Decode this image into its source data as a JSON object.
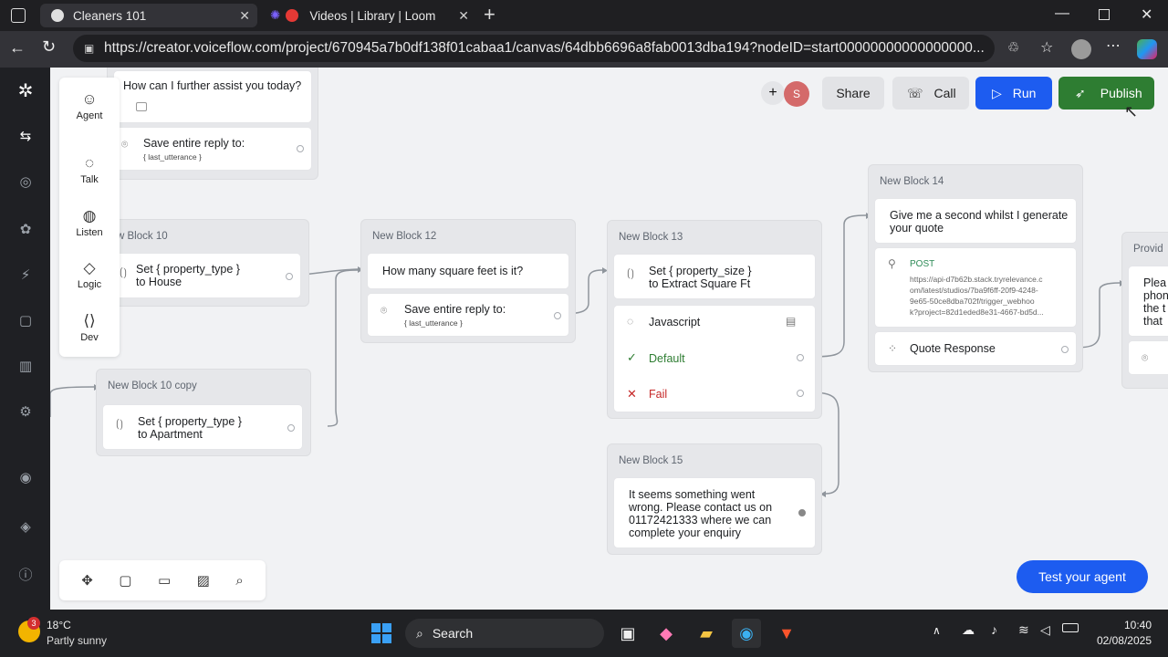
{
  "browser": {
    "tabs": [
      {
        "title": "Cleaners 101"
      },
      {
        "title": "Videos | Library | Loom"
      }
    ],
    "url": "https://creator.voiceflow.com/project/670945a7b0df138f01cabaa1/canvas/64dbb6696a8fab0013dba194?nodeID=start00000000000000000..."
  },
  "palette": {
    "items": [
      {
        "label": "Agent",
        "icon": "robot-icon"
      },
      {
        "label": "Talk",
        "icon": "chat-bubble-icon"
      },
      {
        "label": "Listen",
        "icon": "person-icon"
      },
      {
        "label": "Logic",
        "icon": "diamond-icon"
      },
      {
        "label": "Dev",
        "icon": "code-icon"
      }
    ]
  },
  "toolbar": {
    "avatar_initial": "S",
    "share": "Share",
    "call": "Call",
    "run": "Run",
    "publish": "Publish"
  },
  "blocks": {
    "top": {
      "prompt": "How can I further assist you today?",
      "capture_label": "Save entire reply to:",
      "capture_var": "{ last_utterance }"
    },
    "b10": {
      "title": "w Block 10",
      "set_label": "Set",
      "set_var": "{ property_type }",
      "to": "to",
      "value": "House"
    },
    "b10copy": {
      "title": "New Block 10 copy",
      "set_label": "Set",
      "set_var": "{ property_type }",
      "to": "to",
      "value": "Apartment"
    },
    "b12": {
      "title": "New Block 12",
      "prompt": "How many square feet is it?",
      "capture_label": "Save entire reply to:",
      "capture_var": "{ last_utterance }"
    },
    "b13": {
      "title": "New Block 13",
      "set_label": "Set",
      "set_var": "{ property_size }",
      "to": "to",
      "value": "Extract Square Ft",
      "js": "Javascript",
      "default": "Default",
      "fail": "Fail"
    },
    "b14": {
      "title": "New Block 14",
      "text_line1": "Give me a second whilst I generate",
      "text_line2": "your quote",
      "method": "POST",
      "api_line1": "https://api-d7b62b.stack.tryrelevance.c",
      "api_line2": "om/latest/studios/7ba9f6ff-20f9-4248-",
      "api_line3": "9e65-50ce8dba702f/trigger_webhoo",
      "api_line4": "k?project=82d1eded8e31-4667-bd5d...",
      "response": "Quote Response"
    },
    "b15": {
      "title": "New Block 15",
      "text_line1": "It seems something went",
      "text_line2": "wrong. Please contact us on",
      "text_line3": "01172421333 where we can",
      "text_line4": "complete your enquiry"
    },
    "partial": {
      "title": "Provid",
      "text_line1": "Plea",
      "text_line2": "phon",
      "text_line3": "the t",
      "text_line4": "that"
    }
  },
  "test_agent": "Test your agent",
  "taskbar": {
    "temperature": "18°C",
    "weather": "Partly sunny",
    "weather_badge": "3",
    "search": "Search",
    "time": "10:40",
    "date": "02/08/2025"
  },
  "colors": {
    "run_blue": "#1d5cf0",
    "publish_green": "#2e7d32",
    "default_green": "#2e7d32",
    "fail_red": "#c62828",
    "post_green": "#2e8b57"
  }
}
